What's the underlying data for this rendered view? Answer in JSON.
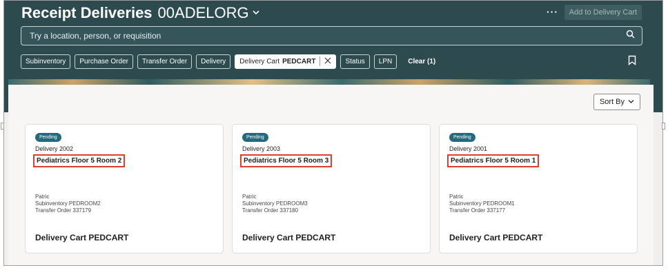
{
  "header": {
    "title": "Receipt Deliveries",
    "org": "00ADELORG",
    "more": "···",
    "add_to_cart": "Add to Delivery Cart"
  },
  "search": {
    "placeholder": "Try a location, person, or requisition"
  },
  "filters": {
    "items": [
      "Subinventory",
      "Purchase Order",
      "Transfer Order",
      "Delivery"
    ],
    "selected": {
      "label": "Delivery Cart",
      "value": "PEDCART"
    },
    "items_after": [
      "Status",
      "LPN"
    ],
    "clear": "Clear (1)"
  },
  "sort": {
    "label": "Sort By"
  },
  "cards": [
    {
      "status": "Pending",
      "delivery": "Delivery 2002",
      "location": "Pediatrics Floor 5 Room 2",
      "person": "Patric",
      "subinventory": "Subinventory PEDROOM2",
      "transfer_order": "Transfer Order 337179",
      "cart": "Delivery Cart PEDCART"
    },
    {
      "status": "Pending",
      "delivery": "Delivery 2003",
      "location": "Pediatrics Floor 5 Room 3",
      "person": "Patric",
      "subinventory": "Subinventory PEDROOM3",
      "transfer_order": "Transfer Order 337180",
      "cart": "Delivery Cart PEDCART"
    },
    {
      "status": "Pending",
      "delivery": "Delivery 2001",
      "location": "Pediatrics Floor 5 Room 1",
      "person": "Patric",
      "subinventory": "Subinventory PEDROOM1",
      "transfer_order": "Transfer Order 337177",
      "cart": "Delivery Cart PEDCART"
    }
  ],
  "colors": {
    "header_bg": "#2d4b4f",
    "badge": "#236b7c",
    "highlight": "#e03d2f"
  }
}
